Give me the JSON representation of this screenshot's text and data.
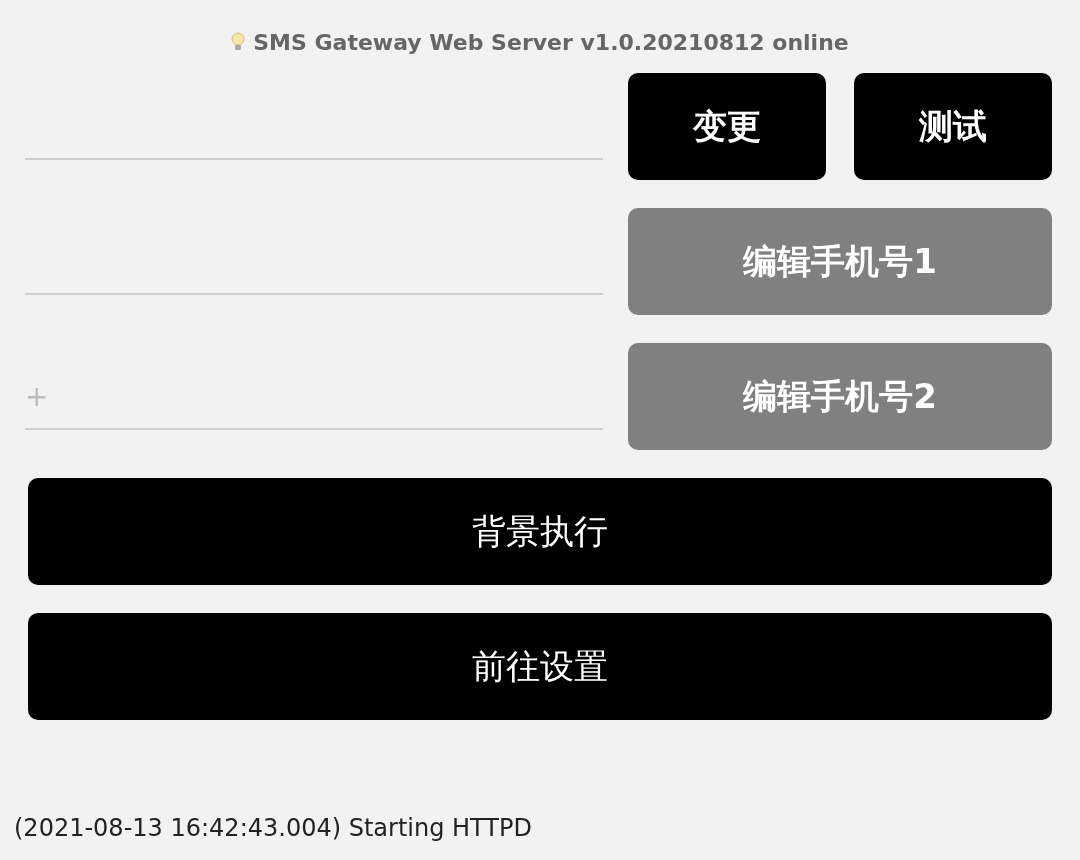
{
  "header": {
    "title": "SMS Gateway Web Server v1.0.20210812 online"
  },
  "rows": [
    {
      "field": {},
      "buttons": [
        {
          "label": "变更",
          "kind": "primary"
        },
        {
          "label": "测试",
          "kind": "primary"
        }
      ]
    },
    {
      "field": {},
      "buttons": [
        {
          "label": "编辑手机号1",
          "kind": "secondary"
        }
      ]
    },
    {
      "field": {
        "prefix": "+"
      },
      "buttons": [
        {
          "label": "编辑手机号2",
          "kind": "secondary"
        }
      ]
    }
  ],
  "actions": [
    {
      "label": "背景执行"
    },
    {
      "label": "前往设置"
    }
  ],
  "log": "(2021-08-13 16:42:43.004) Starting HTTPD"
}
